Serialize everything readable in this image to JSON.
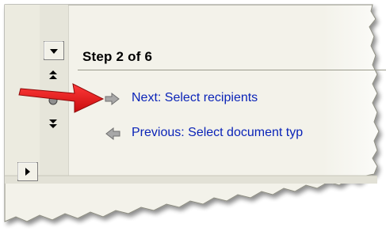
{
  "wizard": {
    "step_label": "Step 2 of 6",
    "next_link": "Next: Select recipients",
    "previous_link": "Previous: Select document typ"
  },
  "icons": {
    "next": "gray-arrow-right-icon",
    "previous": "gray-arrow-left-icon",
    "callout": "red-callout-arrow-icon",
    "scroll_down": "chevron-down-icon",
    "page_up": "double-up-icon",
    "select_browse": "circle-icon",
    "page_down": "double-down-icon",
    "scroll_right": "chevron-right-icon"
  },
  "colors": {
    "link": "#0b24b8",
    "callout": "#e01515",
    "panel": "#f0efe6"
  }
}
